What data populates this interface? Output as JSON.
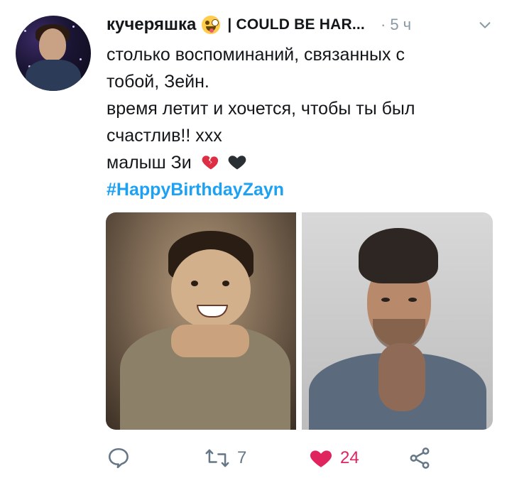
{
  "tweet": {
    "author_name": "кучеряшка",
    "author_handle": "| COULD BE HAR...",
    "separator": "·",
    "time": "5 ч",
    "lines": [
      "столько воспоминаний, связанных с",
      "тобой, Зейн.",
      "время летит и хочется, чтобы ты был",
      "счастлив!! xxx",
      "малыш Зи"
    ],
    "hashtag": "#HappyBirthdayZayn",
    "emoji_after_name": "zany-face-emoji",
    "emojis_after_text": [
      "broken-heart-emoji",
      "black-heart-emoji"
    ]
  },
  "actions": {
    "reply_count": "",
    "retweet_count": "7",
    "like_count": "24",
    "liked": true
  },
  "colors": {
    "link": "#1da1f2",
    "muted": "#8899a6",
    "like": "#e0245e"
  }
}
